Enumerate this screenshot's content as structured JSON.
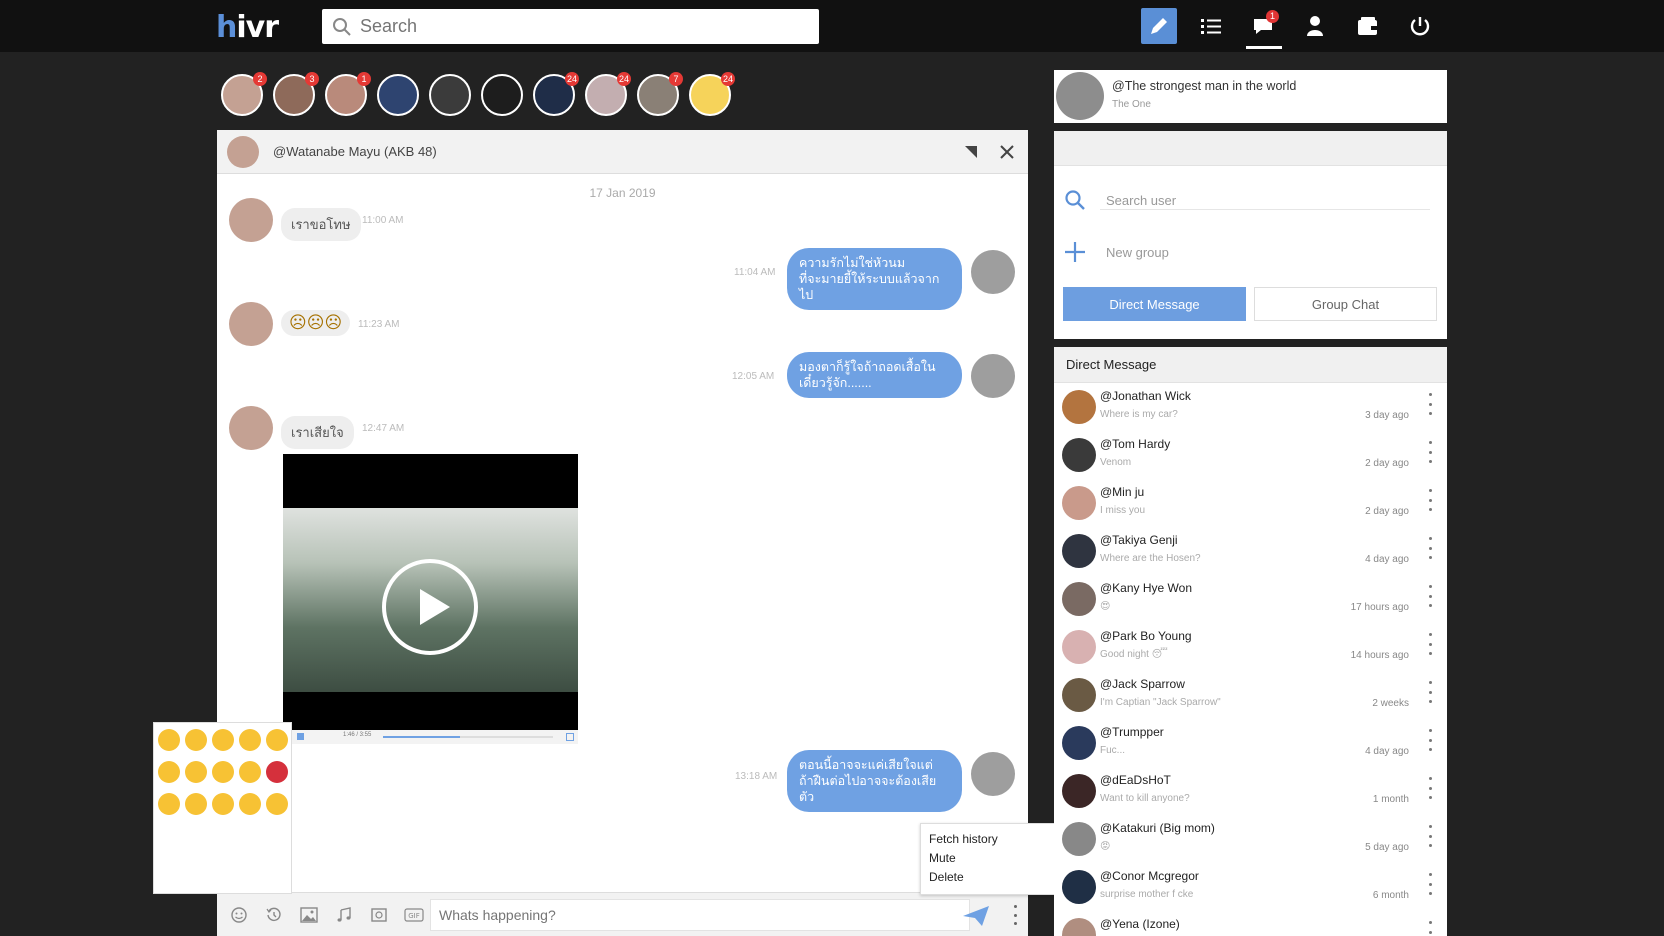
{
  "app": {
    "logo": "hivr"
  },
  "search": {
    "placeholder": "Search"
  },
  "nav": {
    "messages_badge": "1"
  },
  "stories": [
    {
      "badge": "2"
    },
    {
      "badge": "3"
    },
    {
      "badge": "1"
    },
    {
      "badge": ""
    },
    {
      "badge": ""
    },
    {
      "badge": ""
    },
    {
      "badge": "24"
    },
    {
      "badge": "24"
    },
    {
      "badge": "7"
    },
    {
      "badge": "24"
    }
  ],
  "chat": {
    "contact": "@Watanabe Mayu (AKB 48)",
    "date": "17 Jan 2019",
    "messages": [
      {
        "dir": "in",
        "text": "เราขอโทษ",
        "time": "11:00 AM"
      },
      {
        "dir": "out",
        "line1": "ความรักไม่ใช่หัวนม",
        "line2": "ที่จะมายยี้ให้ระบบแล้วจากไป",
        "time": "11:04 AM"
      },
      {
        "dir": "in",
        "text": "☹☹☹",
        "time": "11:23 AM"
      },
      {
        "dir": "out",
        "line1": "มองตาก็รู้ใจถ้าถอดเสื้อใน",
        "line2": "เดี๋ยวรู้จัก.......",
        "time": "12:05 AM"
      },
      {
        "dir": "in",
        "text": "เราเสียใจ",
        "time": "12:47 AM"
      },
      {
        "dir": "out",
        "line1": "ตอนนี้อาจจะแค่เสียใจแต่",
        "line2": "ถ้าฝืนต่อไปอาจจะต้องเสียตัว",
        "time": "13:18 AM"
      }
    ],
    "video": {
      "time": "1:46 / 3:55",
      "progress": 0.45
    },
    "composer": {
      "placeholder": "Whats happening?"
    }
  },
  "context_menu": [
    "Fetch history",
    "Mute",
    "Delete"
  ],
  "me": {
    "name": "@The strongest man in the world",
    "subtitle": "The One"
  },
  "sidebar": {
    "search_placeholder": "Search user",
    "new_group": "New group",
    "tab_dm": "Direct Message",
    "tab_group": "Group Chat"
  },
  "direct_messages": {
    "title": "Direct Message",
    "items": [
      {
        "name": "@Jonathan Wick",
        "preview": "Where is my car?",
        "time": "3 day ago",
        "color": "#b3743f"
      },
      {
        "name": "@Tom Hardy",
        "preview": "Venom",
        "time": "2 day ago",
        "color": "#3a3a3a"
      },
      {
        "name": "@Min ju",
        "preview": "I miss you",
        "time": "2 day ago",
        "color": "#c99a8b"
      },
      {
        "name": "@Takiya Genji",
        "preview": "Where are the Hosen?",
        "time": "4 day ago",
        "color": "#2f3440"
      },
      {
        "name": "@Kany Hye Won",
        "preview": "😍",
        "time": "17 hours ago",
        "color": "#7a6a63"
      },
      {
        "name": "@Park Bo Young",
        "preview": "Good night 😴",
        "time": "14 hours ago",
        "color": "#d8b1b1"
      },
      {
        "name": "@Jack Sparrow",
        "preview": "I'm Captian \"Jack Sparrow\"",
        "time": "2 weeks",
        "color": "#6a5a44"
      },
      {
        "name": "@Trumpper",
        "preview": "Fuc...",
        "time": "4 day ago",
        "color": "#2a3a5c"
      },
      {
        "name": "@dEaDsHoT",
        "preview": "Want to kill anyone?",
        "time": "1 month",
        "color": "#3b2626"
      },
      {
        "name": "@Katakuri (Big mom)",
        "preview": "😡",
        "time": "5 day ago",
        "color": "#888888"
      },
      {
        "name": "@Conor Mcgregor",
        "preview": "surprise mother f cke",
        "time": "6 month",
        "color": "#1f2f45"
      },
      {
        "name": "@Yena (Izone)",
        "preview": "",
        "time": "",
        "color": "#b08e80"
      }
    ]
  }
}
